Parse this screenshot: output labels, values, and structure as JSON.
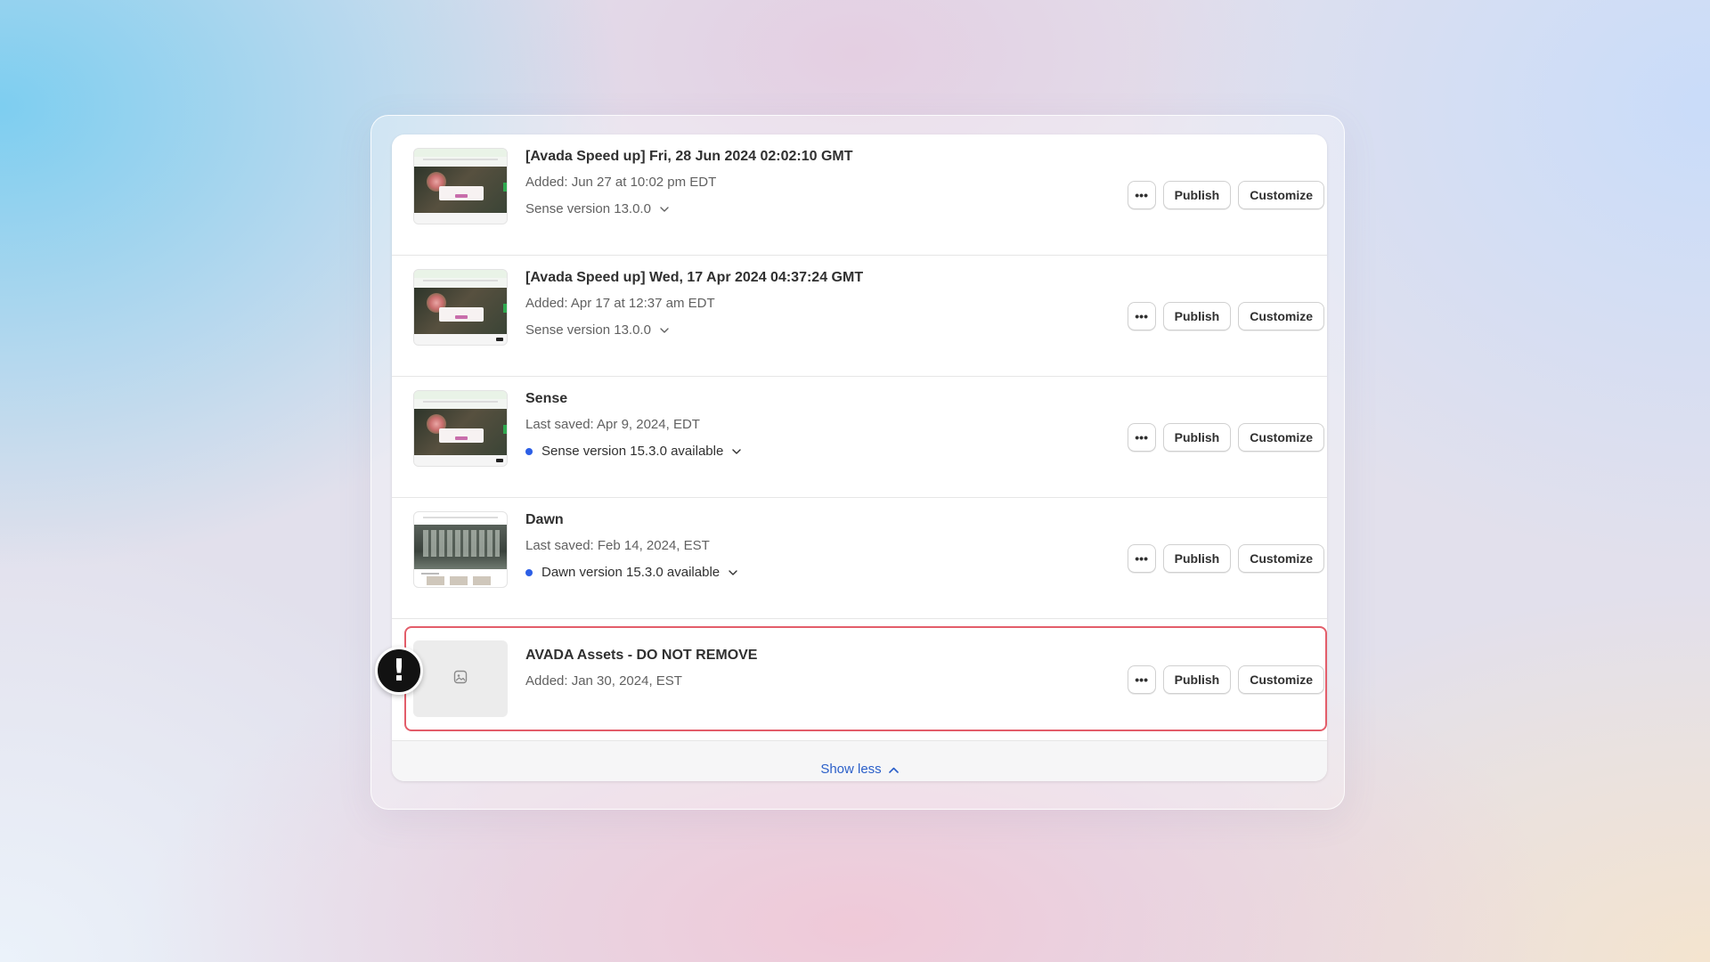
{
  "themes": [
    {
      "title": "[Avada Speed up] Fri, 28 Jun 2024 02:02:10 GMT",
      "subtitle": "Added: Jun 27 at 10:02 pm EDT",
      "version": "Sense version 13.0.0",
      "update_available": false
    },
    {
      "title": "[Avada Speed up] Wed, 17 Apr 2024 04:37:24 GMT",
      "subtitle": "Added: Apr 17 at 12:37 am EDT",
      "version": "Sense version 13.0.0",
      "update_available": false
    },
    {
      "title": "Sense",
      "subtitle": "Last saved: Apr 9, 2024, EDT",
      "version": "Sense version 15.3.0 available",
      "update_available": true
    },
    {
      "title": "Dawn",
      "subtitle": "Last saved: Feb 14, 2024, EST",
      "version": "Dawn version 15.3.0 available",
      "update_available": true
    },
    {
      "title": "AVADA Assets - DO NOT REMOVE",
      "subtitle": "Added: Jan 30, 2024, EST",
      "highlighted": true
    }
  ],
  "actions": {
    "more_label": "•••",
    "publish_label": "Publish",
    "customize_label": "Customize"
  },
  "footer": {
    "show_less_label": "Show less"
  },
  "alert_badge": {
    "symbol": "!"
  },
  "colors": {
    "highlight_border": "#e35d6a",
    "update_dot": "#2c5fe6",
    "link": "#2b5fc9"
  }
}
